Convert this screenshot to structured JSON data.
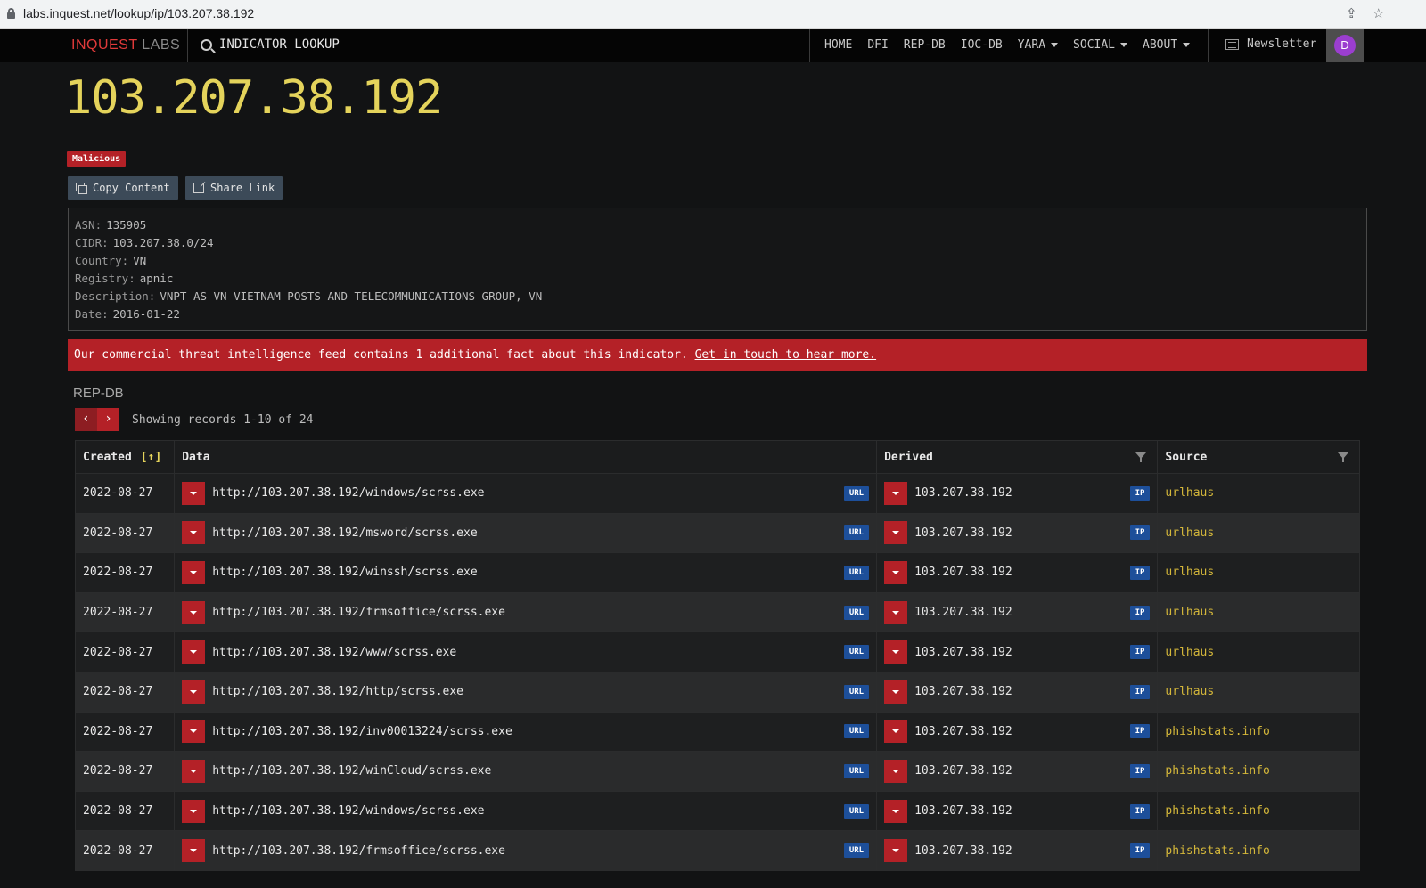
{
  "browser": {
    "url": "labs.inquest.net/lookup/ip/103.207.38.192"
  },
  "nav": {
    "logo_part1": "INQUEST",
    "logo_part2": "LABS",
    "lookup_label": "INDICATOR LOOKUP",
    "links": [
      "HOME",
      "DFI",
      "REP-DB",
      "IOC-DB",
      "YARA",
      "SOCIAL",
      "ABOUT"
    ],
    "newsletter": "Newsletter",
    "avatar_initial": "D"
  },
  "indicator": {
    "ip": "103.207.38.192",
    "badge": "Malicious",
    "copy_label": "Copy Content",
    "share_label": "Share Link"
  },
  "info": [
    {
      "key": "ASN:",
      "value": "135905"
    },
    {
      "key": "CIDR:",
      "value": "103.207.38.0/24"
    },
    {
      "key": "Country:",
      "value": "VN"
    },
    {
      "key": "Registry:",
      "value": "apnic"
    },
    {
      "key": "Description:",
      "value": "VNPT-AS-VN VIETNAM POSTS AND TELECOMMUNICATIONS GROUP, VN"
    },
    {
      "key": "Date:",
      "value": "2016-01-22"
    }
  ],
  "alert": {
    "text": "Our commercial threat intelligence feed contains 1 additional fact about this indicator. ",
    "link": "Get in touch to hear more."
  },
  "repdb": {
    "title": "REP-DB",
    "prev": "‹",
    "next": "›",
    "showing": "Showing records 1-10 of 24",
    "headers": {
      "created": "Created",
      "sort": "[↑]",
      "data": "Data",
      "derived": "Derived",
      "source": "Source"
    },
    "rows": [
      {
        "created": "2022-08-27",
        "data": "http://103.207.38.192/windows/scrss.exe",
        "data_type": "URL",
        "derived": "103.207.38.192",
        "derived_type": "IP",
        "source": "urlhaus"
      },
      {
        "created": "2022-08-27",
        "data": "http://103.207.38.192/msword/scrss.exe",
        "data_type": "URL",
        "derived": "103.207.38.192",
        "derived_type": "IP",
        "source": "urlhaus"
      },
      {
        "created": "2022-08-27",
        "data": "http://103.207.38.192/winssh/scrss.exe",
        "data_type": "URL",
        "derived": "103.207.38.192",
        "derived_type": "IP",
        "source": "urlhaus"
      },
      {
        "created": "2022-08-27",
        "data": "http://103.207.38.192/frmsoffice/scrss.exe",
        "data_type": "URL",
        "derived": "103.207.38.192",
        "derived_type": "IP",
        "source": "urlhaus"
      },
      {
        "created": "2022-08-27",
        "data": "http://103.207.38.192/www/scrss.exe",
        "data_type": "URL",
        "derived": "103.207.38.192",
        "derived_type": "IP",
        "source": "urlhaus"
      },
      {
        "created": "2022-08-27",
        "data": "http://103.207.38.192/http/scrss.exe",
        "data_type": "URL",
        "derived": "103.207.38.192",
        "derived_type": "IP",
        "source": "urlhaus"
      },
      {
        "created": "2022-08-27",
        "data": "http://103.207.38.192/inv00013224/scrss.exe",
        "data_type": "URL",
        "derived": "103.207.38.192",
        "derived_type": "IP",
        "source": "phishstats.info"
      },
      {
        "created": "2022-08-27",
        "data": "http://103.207.38.192/winCloud/scrss.exe",
        "data_type": "URL",
        "derived": "103.207.38.192",
        "derived_type": "IP",
        "source": "phishstats.info"
      },
      {
        "created": "2022-08-27",
        "data": "http://103.207.38.192/windows/scrss.exe",
        "data_type": "URL",
        "derived": "103.207.38.192",
        "derived_type": "IP",
        "source": "phishstats.info"
      },
      {
        "created": "2022-08-27",
        "data": "http://103.207.38.192/frmsoffice/scrss.exe",
        "data_type": "URL",
        "derived": "103.207.38.192",
        "derived_type": "IP",
        "source": "phishstats.info"
      }
    ]
  },
  "colors": {
    "accent_red": "#b42127",
    "title_yellow": "#e4d35b",
    "tag_blue": "#1d4f9a",
    "source_gold": "#d4b73a"
  }
}
